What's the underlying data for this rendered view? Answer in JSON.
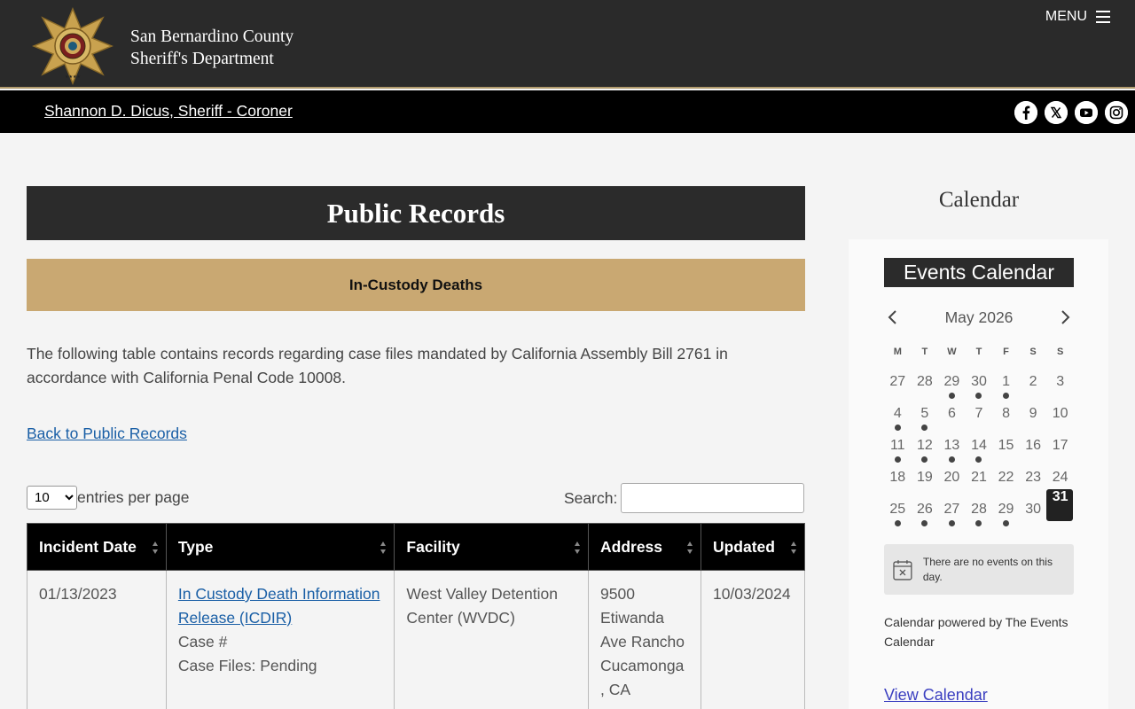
{
  "header": {
    "dept_line1": "San Bernardino County",
    "dept_line2": "Sheriff's Department",
    "menu_label": "MENU",
    "sheriff_link": "Shannon D. Dicus, Sheriff - Coroner",
    "social_icons": [
      "facebook-icon",
      "x-icon",
      "youtube-icon",
      "instagram-icon"
    ]
  },
  "main": {
    "page_title": "Public Records",
    "section_title": "In-Custody Deaths",
    "intro": "The following table contains records regarding case files mandated by California Assembly Bill 2761 in accordance with California Penal Code 10008.",
    "back_link": "Back to Public Records",
    "entries_value": "10",
    "entries_label": "entries per page",
    "search_label": "Search:",
    "search_value": "",
    "table": {
      "columns": [
        "Incident Date",
        "Type",
        "Facility",
        "Address",
        "Updated"
      ],
      "rows": [
        {
          "incident_date": "01/13/2023",
          "type_link": "In Custody Death Information Release (ICDIR)",
          "type_case": "Case #",
          "type_files": "Case Files: Pending",
          "facility": "West Valley Detention Center (WVDC)",
          "address": "9500 Etiwanda Ave Rancho Cucamonga , CA",
          "updated": "10/03/2024"
        }
      ]
    }
  },
  "sidebar": {
    "heading": "Calendar",
    "events_title": "Events Calendar",
    "month_label": "May 2026",
    "days_of_week": [
      "M",
      "T",
      "W",
      "T",
      "F",
      "S",
      "S"
    ],
    "weeks": [
      [
        {
          "d": "27",
          "e": false
        },
        {
          "d": "28",
          "e": false
        },
        {
          "d": "29",
          "e": true
        },
        {
          "d": "30",
          "e": true
        },
        {
          "d": "1",
          "e": true
        },
        {
          "d": "2",
          "e": false
        },
        {
          "d": "3",
          "e": false
        }
      ],
      [
        {
          "d": "4",
          "e": true
        },
        {
          "d": "5",
          "e": true
        },
        {
          "d": "6",
          "e": false
        },
        {
          "d": "7",
          "e": false
        },
        {
          "d": "8",
          "e": false
        },
        {
          "d": "9",
          "e": false
        },
        {
          "d": "10",
          "e": false
        }
      ],
      [
        {
          "d": "11",
          "e": true
        },
        {
          "d": "12",
          "e": true
        },
        {
          "d": "13",
          "e": true
        },
        {
          "d": "14",
          "e": true
        },
        {
          "d": "15",
          "e": false
        },
        {
          "d": "16",
          "e": false
        },
        {
          "d": "17",
          "e": false
        }
      ],
      [
        {
          "d": "18",
          "e": false
        },
        {
          "d": "19",
          "e": false
        },
        {
          "d": "20",
          "e": false
        },
        {
          "d": "21",
          "e": false
        },
        {
          "d": "22",
          "e": false
        },
        {
          "d": "23",
          "e": false
        },
        {
          "d": "24",
          "e": false
        }
      ],
      [
        {
          "d": "25",
          "e": true
        },
        {
          "d": "26",
          "e": true
        },
        {
          "d": "27",
          "e": true
        },
        {
          "d": "28",
          "e": true
        },
        {
          "d": "29",
          "e": true
        },
        {
          "d": "30",
          "e": false
        },
        {
          "d": "31",
          "e": false,
          "today": true
        }
      ]
    ],
    "no_events": "There are no events on this day.",
    "powered_by": "Calendar powered by The Events Calendar",
    "view_calendar": "View Calendar"
  },
  "colors": {
    "header_bg": "#2a2a2a",
    "gold_accent": "#c9a872",
    "link": "#1a5fa6"
  }
}
